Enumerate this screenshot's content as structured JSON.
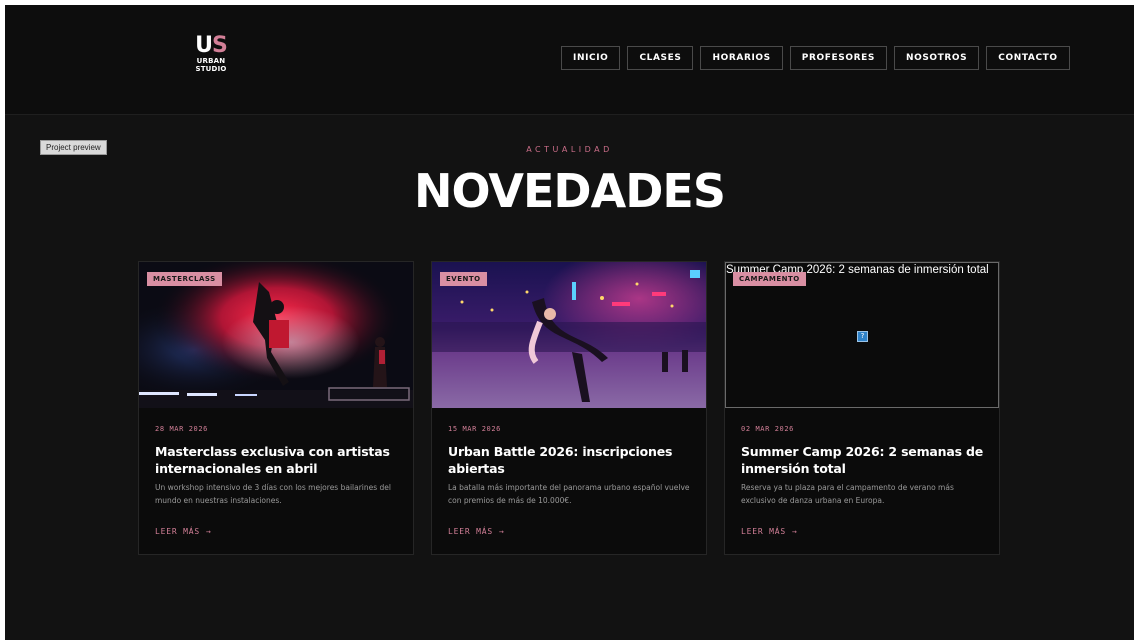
{
  "header": {
    "logo_mark_u": "U",
    "logo_mark_s": "S",
    "logo_line1": "URBAN",
    "logo_line2": "STUDIO",
    "nav": [
      "INICIO",
      "CLASES",
      "HORARIOS",
      "PROFESORES",
      "NOSOTROS",
      "CONTACTO"
    ]
  },
  "preview_badge": "Project preview",
  "section": {
    "kicker": "ACTUALIDAD",
    "title": "NOVEDADES"
  },
  "cards": [
    {
      "tag": "MASTERCLASS",
      "date": "28 MAR 2026",
      "title": "Masterclass exclusiva con artistas internacionales en abril",
      "description": "Un workshop intensivo de 3 días con los mejores bailarines del mundo en nuestras instalaciones.",
      "link": "LEER MÁS",
      "arrow": "→"
    },
    {
      "tag": "EVENTO",
      "date": "15 MAR 2026",
      "title": "Urban Battle 2026: inscripciones abiertas",
      "description": "La batalla más importante del panorama urbano español vuelve con premios de más de 10.000€.",
      "link": "LEER MÁS",
      "arrow": "→"
    },
    {
      "tag": "CAMPAMENTO",
      "image_alt": "Summer Camp 2026: 2 semanas de inmersión total",
      "broken_glyph": "?",
      "date": "02 MAR 2026",
      "title": "Summer Camp 2026: 2 semanas de inmersión total",
      "description": "Reserva ya tu plaza para el campamento de verano más exclusivo de danza urbana en Europa.",
      "link": "LEER MÁS",
      "arrow": "→"
    }
  ],
  "colors": {
    "accent": "#d27f97",
    "tag_bg": "#d98fa3",
    "background": "#121212",
    "card_bg": "#0b0b0b"
  }
}
